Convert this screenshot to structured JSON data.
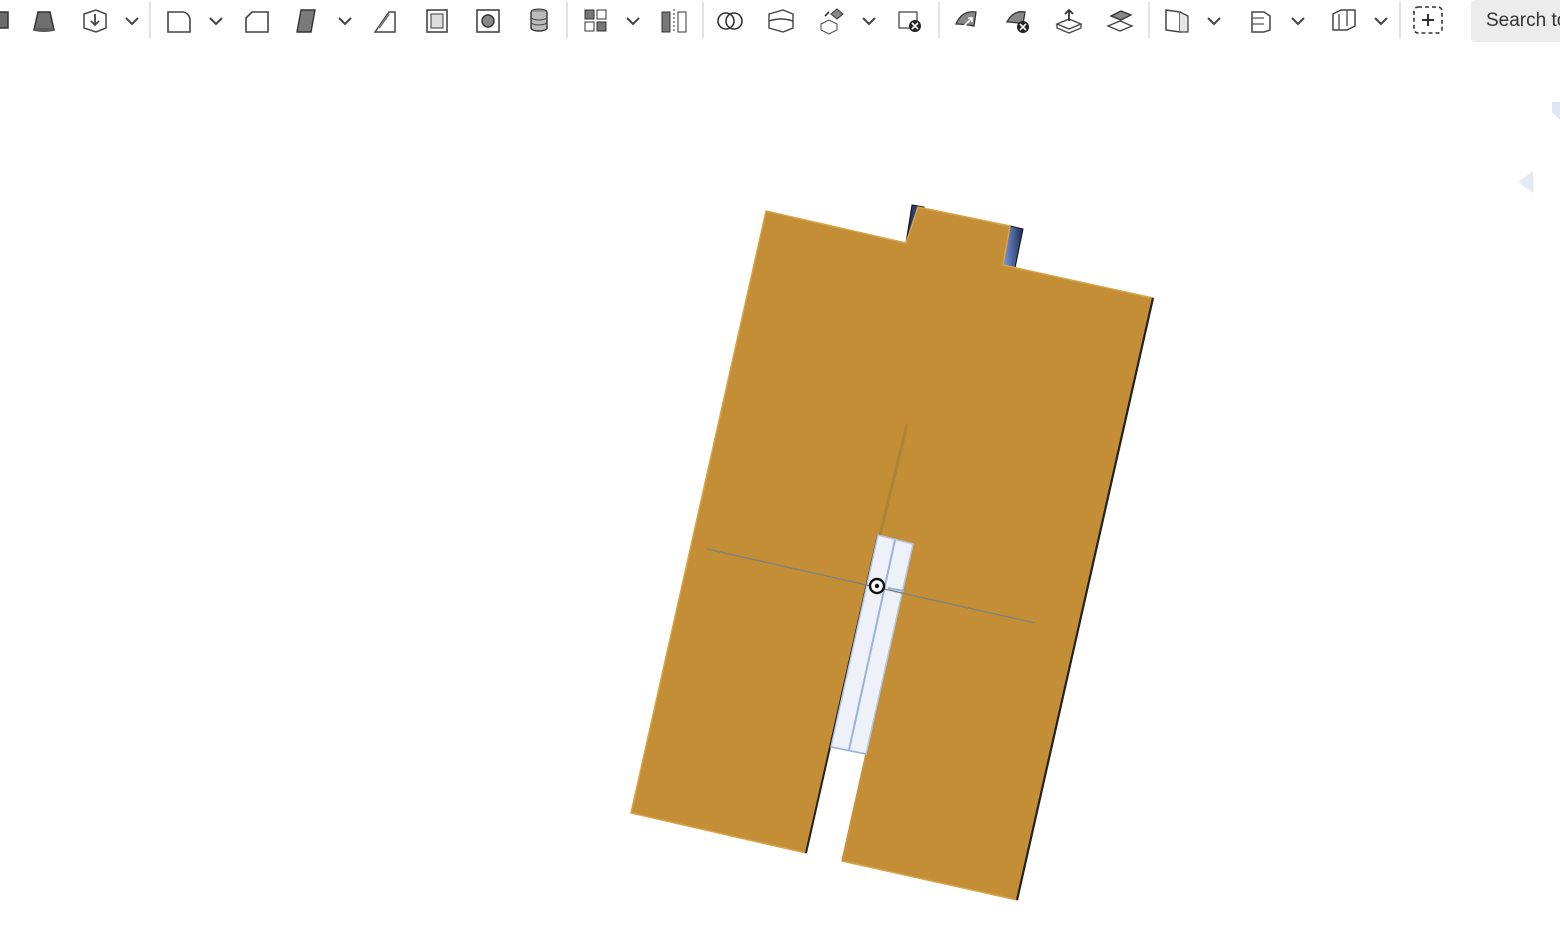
{
  "toolbar": {
    "icons": [
      "extrude-partial-icon",
      "loft-icon",
      "sweep-icon",
      "fillet-icon",
      "chamfer-icon",
      "draft-icon",
      "rib-icon",
      "shell-icon",
      "hole-icon",
      "thread-icon",
      "pattern-icon",
      "mirror-icon",
      "boolean-icon",
      "split-icon",
      "transform-icon",
      "delete-part-icon",
      "modify-fillet-icon",
      "delete-face-icon",
      "move-face-icon",
      "replace-face-icon",
      "plane-icon",
      "sheet-metal-icon",
      "frame-icon",
      "add-feature-icon"
    ],
    "search": {
      "label": "Search tools"
    }
  },
  "viewport": {
    "part_color": "#c38e36",
    "part_edge_color": "#222222",
    "cursor": "origin-target-icon"
  }
}
